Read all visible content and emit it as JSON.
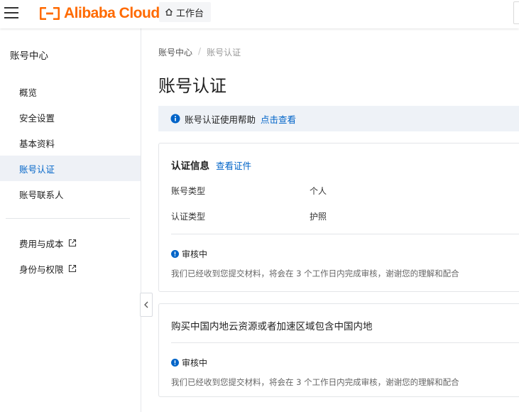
{
  "topbar": {
    "brand": "Alibaba Cloud",
    "workbench_label": "工作台",
    "brand_color": "#ff6a00"
  },
  "sidebar": {
    "title": "账号中心",
    "items": [
      {
        "label": "概览",
        "active": false
      },
      {
        "label": "安全设置",
        "active": false
      },
      {
        "label": "基本资料",
        "active": false
      },
      {
        "label": "账号认证",
        "active": true
      },
      {
        "label": "账号联系人",
        "active": false
      }
    ],
    "external_items": [
      {
        "label": "费用与成本",
        "icon": "external-link-icon"
      },
      {
        "label": "身份与权限",
        "icon": "external-link-icon"
      }
    ]
  },
  "breadcrumb": {
    "parent": "账号中心",
    "separator": "/",
    "current": "账号认证"
  },
  "page": {
    "title": "账号认证"
  },
  "help": {
    "text": "账号认证使用帮助",
    "link": "点击查看"
  },
  "cert_card": {
    "heading": "认证信息",
    "link": "查看证件",
    "rows": [
      {
        "label": "账号类型",
        "value": "个人"
      },
      {
        "label": "认证类型",
        "value": "护照"
      }
    ],
    "status": "审核中",
    "status_desc": "我们已经收到您提交材料，将会在 3 个工作日内完成审核，谢谢您的理解和配合"
  },
  "region_card": {
    "heading": "购买中国内地云资源或者加速区域包含中国内地",
    "status": "审核中",
    "status_desc": "我们已经收到您提交材料，将会在 3 个工作日内完成审核，谢谢您的理解和配合"
  },
  "colors": {
    "accent": "#0064c8",
    "active_bg": "#eef1f6",
    "help_bg": "#eef2f7",
    "status_blue": "#0064c8"
  }
}
